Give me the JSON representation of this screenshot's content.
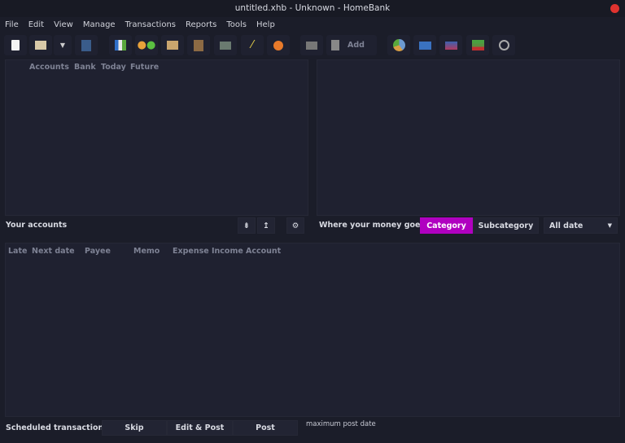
{
  "window": {
    "title": "untitled.xhb - Unknown - HomeBank"
  },
  "menu": [
    "File",
    "Edit",
    "View",
    "Manage",
    "Transactions",
    "Reports",
    "Tools",
    "Help"
  ],
  "toolbar": {
    "add_label": "Add"
  },
  "accounts": {
    "columns": [
      "Accounts",
      "Bank",
      "Today",
      "Future"
    ],
    "title": "Your accounts"
  },
  "spending": {
    "title": "Where your money goes",
    "tab_category": "Category",
    "tab_subcategory": "Subcategory",
    "date_range": "All date",
    "accent": "#b000c0"
  },
  "scheduled": {
    "columns": [
      "Late",
      "Next date",
      "Payee",
      "Memo",
      "Expense",
      "Income",
      "Account"
    ],
    "title": "Scheduled transactions",
    "skip": "Skip",
    "edit_post": "Edit & Post",
    "post": "Post",
    "max_post_date_label": "maximum post date"
  }
}
